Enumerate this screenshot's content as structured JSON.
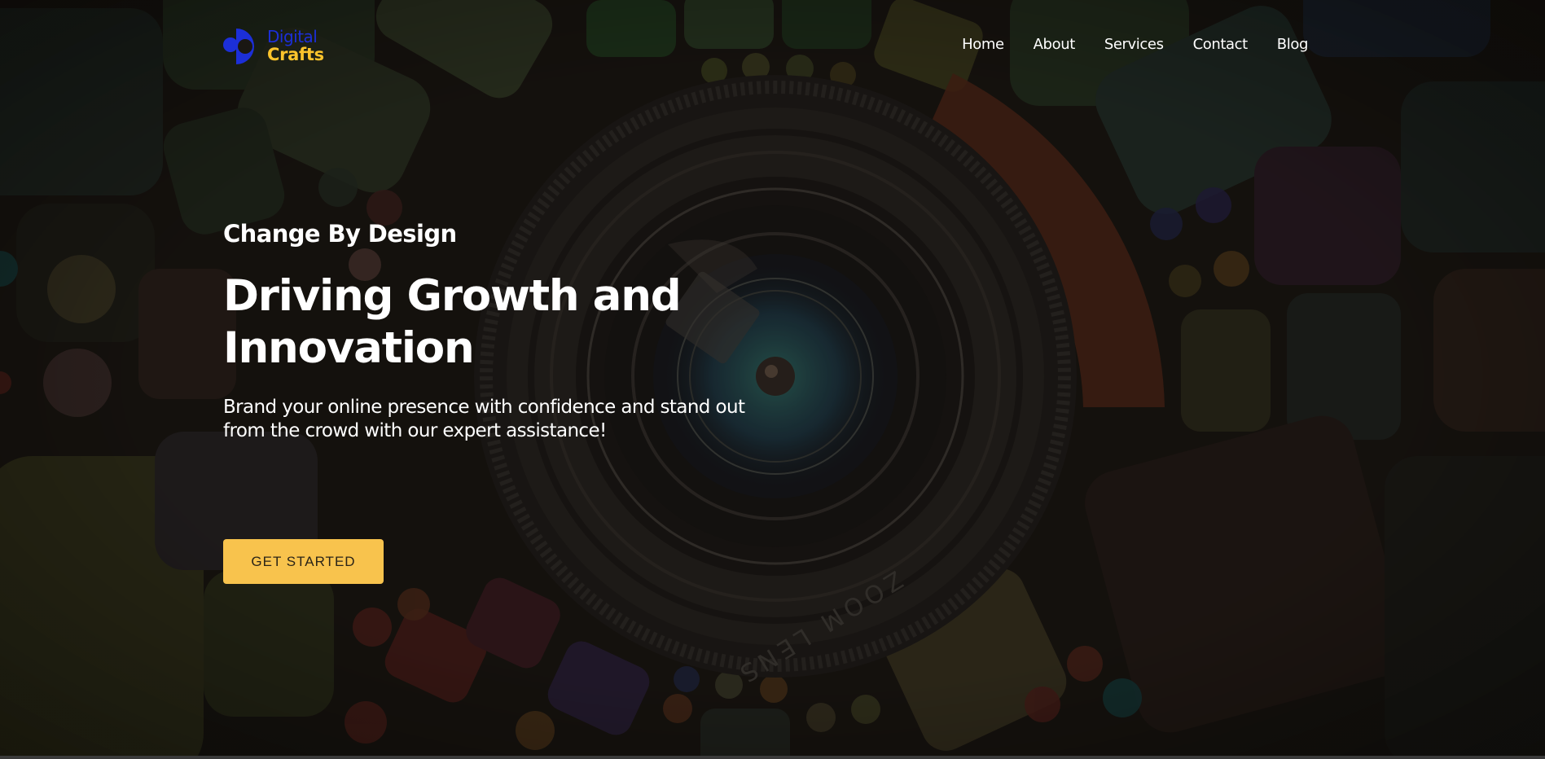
{
  "brand": {
    "line1": "Digital",
    "line2": "Crafts",
    "primary_color": "#1c2fd8",
    "accent_color": "#fcc42c"
  },
  "nav": {
    "items": [
      {
        "label": "Home"
      },
      {
        "label": "About"
      },
      {
        "label": "Services"
      },
      {
        "label": "Contact"
      },
      {
        "label": "Blog"
      }
    ]
  },
  "hero": {
    "eyebrow": "Change By Design",
    "headline": "Driving Growth and Innovation",
    "subtext": "Brand your online presence with confidence and stand out from the crowd with our expert assistance!",
    "cta_label": "GET STARTED",
    "cta_color": "#f8c34d",
    "lens_text": "ZOOM LENS",
    "background_image": "dark-camera-lens-mosaic"
  }
}
